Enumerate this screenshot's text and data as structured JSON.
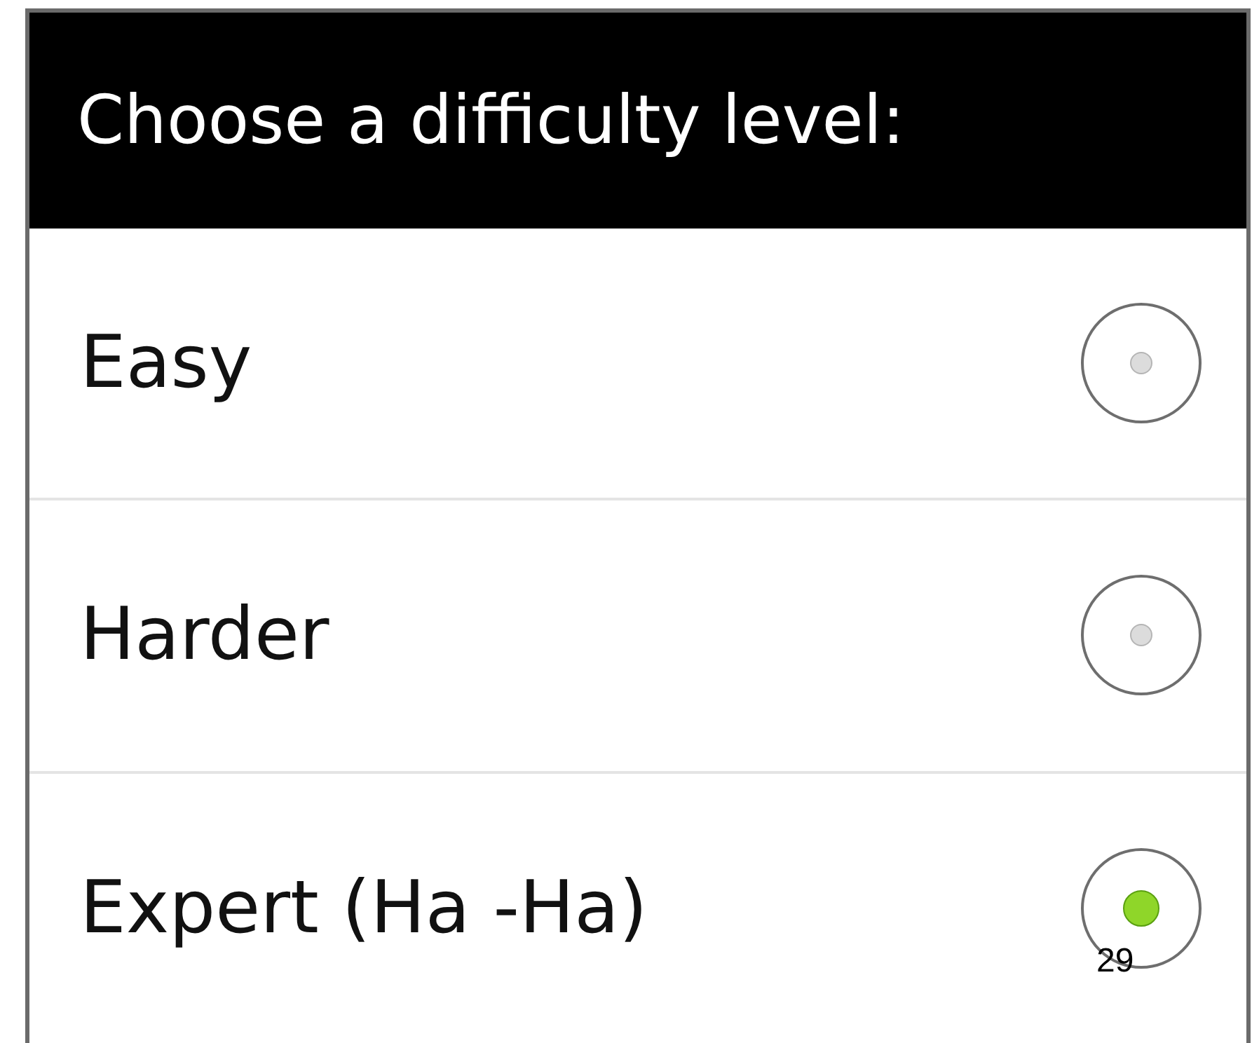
{
  "dialog": {
    "title": "Choose a difficulty level:"
  },
  "options": [
    {
      "label": "Easy",
      "selected": false
    },
    {
      "label": "Harder",
      "selected": false
    },
    {
      "label": "Expert (Ha -Ha)",
      "selected": true
    }
  ],
  "page_number": "29"
}
